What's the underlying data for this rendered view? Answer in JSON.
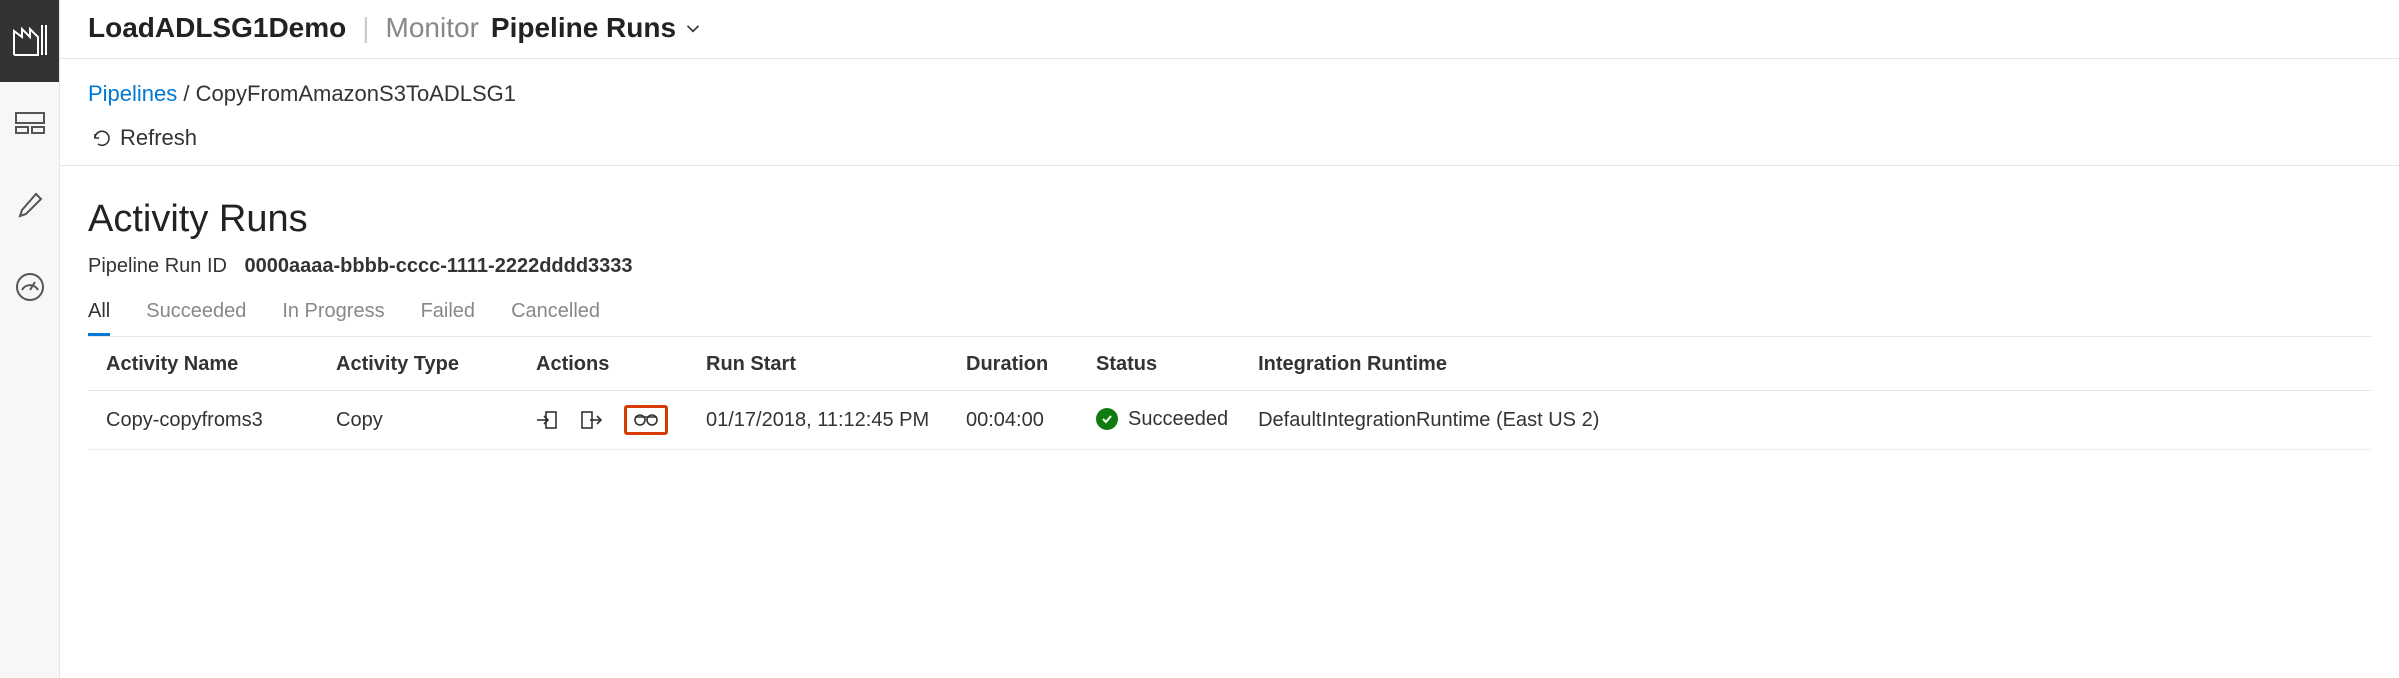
{
  "header": {
    "factory_name": "LoadADLSG1Demo",
    "section": "Monitor",
    "page": "Pipeline Runs"
  },
  "breadcrumb": {
    "root": "Pipelines",
    "separator": "/",
    "current": "CopyFromAmazonS3ToADLSG1"
  },
  "toolbar": {
    "refresh": "Refresh"
  },
  "page_title": "Activity Runs",
  "run_id": {
    "label": "Pipeline Run ID",
    "value": "0000aaaa-bbbb-cccc-1111-2222dddd3333"
  },
  "filters": [
    "All",
    "Succeeded",
    "In Progress",
    "Failed",
    "Cancelled"
  ],
  "filters_active_index": 0,
  "table": {
    "headers": [
      "Activity Name",
      "Activity Type",
      "Actions",
      "Run Start",
      "Duration",
      "Status",
      "Integration Runtime"
    ],
    "rows": [
      {
        "activity_name": "Copy-copyfroms3",
        "activity_type": "Copy",
        "run_start": "01/17/2018, 11:12:45 PM",
        "duration": "00:04:00",
        "status": "Succeeded",
        "integration_runtime": "DefaultIntegrationRuntime (East US 2)"
      }
    ]
  }
}
